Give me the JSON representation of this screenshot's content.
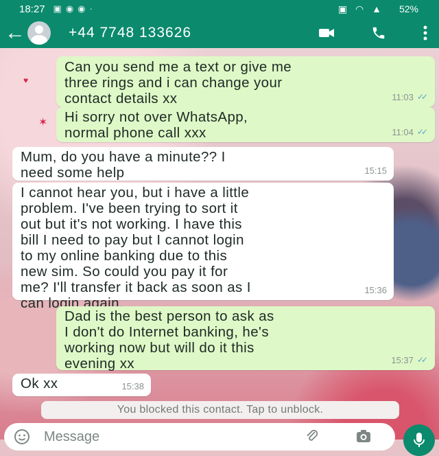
{
  "status_bar": {
    "time": "18:27",
    "battery": "52%"
  },
  "header": {
    "contact": "+44 7748 133626"
  },
  "messages": [
    {
      "dir": "out",
      "text": "Can you send me a text or give me\nthree rings and i can change your\ncontact details xx",
      "time": "11:03"
    },
    {
      "dir": "out",
      "text": "Hi sorry not over WhatsApp,\nnormal phone call xxx",
      "time": "11:04"
    },
    {
      "dir": "in",
      "text": "Mum, do you have a minute?? I\nneed some help",
      "time": "15:15"
    },
    {
      "dir": "in",
      "text": "I cannot hear you, but i have a little\nproblem. I've  been trying to sort it\nout but it's not working. I have this\nbill I need to pay but I cannot login\nto my online banking due to this\nnew sim. So could you pay it for\nme? I'll transfer it back as soon as I\ncan login again.",
      "time": "15:36"
    },
    {
      "dir": "out",
      "text": "Dad is the best person to ask as\nI don't do Internet banking, he's\nworking now but will do it this\nevening xx",
      "time": "15:37"
    },
    {
      "dir": "in",
      "text": "Ok xx",
      "time": "15:38"
    }
  ],
  "system_notice": "You blocked this contact. Tap to unblock.",
  "input": {
    "placeholder": "Message"
  },
  "colors": {
    "header": "#0b8a6d",
    "outgoing": "#dff8c7",
    "incoming": "#ffffff",
    "ticks": "#5aa6cc"
  }
}
